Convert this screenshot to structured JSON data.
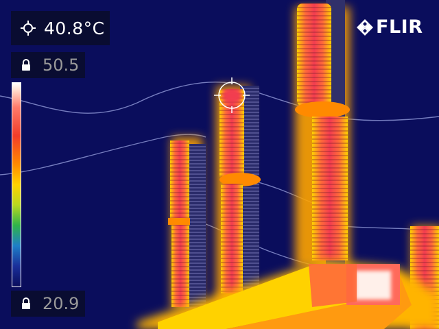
{
  "readouts": {
    "spot_temp": "40.8°C",
    "scale_max": "50.5",
    "scale_min": "20.9"
  },
  "brand": {
    "logo_text": "FLIR"
  },
  "icons": {
    "spot": "crosshair-icon",
    "lock": "lock-icon",
    "logo": "flir-logo-icon"
  },
  "palette": {
    "background": "#0a0d5c",
    "hot": "#f23c28",
    "warm": "#ffd200",
    "white_hot": "#ffffff"
  }
}
